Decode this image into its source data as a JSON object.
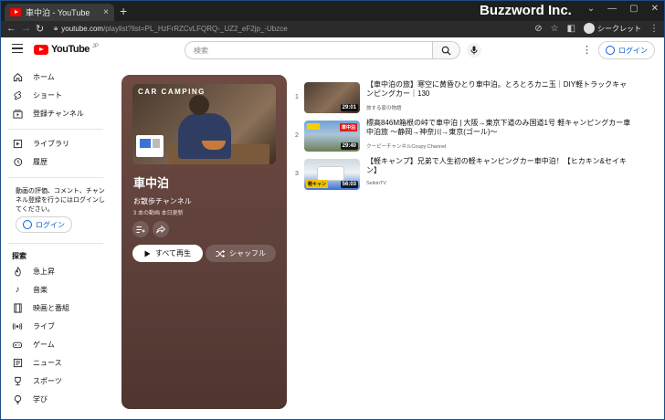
{
  "browser": {
    "tab_title": "車中泊 - YouTube",
    "tab_close": "×",
    "new_tab": "+",
    "brand": "Buzzword Inc.",
    "window_controls": [
      "⌄",
      "—",
      "▢",
      "✕"
    ],
    "url_host": "youtube.com",
    "url_path": "/playlist?list=PL_HzFrRZCvLFQRQ-_UZ2_eF2jp_-Ubzce",
    "incognito_label": "シークレット"
  },
  "header": {
    "logo_text": "YouTube",
    "logo_region": "JP",
    "search_placeholder": "検索",
    "login_label": "ログイン"
  },
  "sidebar": {
    "items": [
      {
        "label": "ホーム",
        "icon": "home-icon"
      },
      {
        "label": "ショート",
        "icon": "shorts-icon"
      },
      {
        "label": "登録チャンネル",
        "icon": "subscriptions-icon"
      },
      {
        "label": "ライブラリ",
        "icon": "library-icon"
      },
      {
        "label": "履歴",
        "icon": "history-icon"
      }
    ],
    "note": "動画の評価、コメント、チャンネル登録を行うにはログインしてください。",
    "login_label": "ログイン",
    "explore_heading": "探索",
    "explore_items": [
      {
        "label": "急上昇",
        "icon": "trending-icon"
      },
      {
        "label": "音楽",
        "icon": "music-icon"
      },
      {
        "label": "映画と番組",
        "icon": "movies-icon"
      },
      {
        "label": "ライブ",
        "icon": "live-icon"
      },
      {
        "label": "ゲーム",
        "icon": "gaming-icon"
      },
      {
        "label": "ニュース",
        "icon": "news-icon"
      },
      {
        "label": "スポーツ",
        "icon": "sports-icon"
      },
      {
        "label": "学び",
        "icon": "learning-icon"
      }
    ]
  },
  "playlist": {
    "thumb_caption": "CAR CAMPING",
    "title": "車中泊",
    "owner": "お散歩チャンネル",
    "meta": "3 本の動画  本日更新",
    "play_all_label": "すべて再生",
    "shuffle_label": "シャッフル",
    "accent_color": "#6e4a43"
  },
  "videos": [
    {
      "index": "1",
      "title": "【車中泊の旅】寒空に黄昏ひとり車中泊。とろとろカニ玉｜DIY軽トラックキャンピングカー｜130",
      "channel": "旅する家の物語",
      "duration": "29:01"
    },
    {
      "index": "2",
      "title": "標高846M箱根の峠で車中泊 | 大阪→東京下道のみ国道1号 軽キャンピングカー車中泊旅 ～静岡→神奈川→東京(ゴール)～",
      "channel": "クーピーチャンネルCoupy Channel",
      "duration": "29:40",
      "badge": "車中泊"
    },
    {
      "index": "3",
      "title": "【軽キャンプ】兄弟で人生初の軽キャンピングカー車中泊！【ヒカキン&セイキン】",
      "channel": "SeikinTV",
      "duration": "56:03",
      "badge": "軽キャン"
    }
  ]
}
